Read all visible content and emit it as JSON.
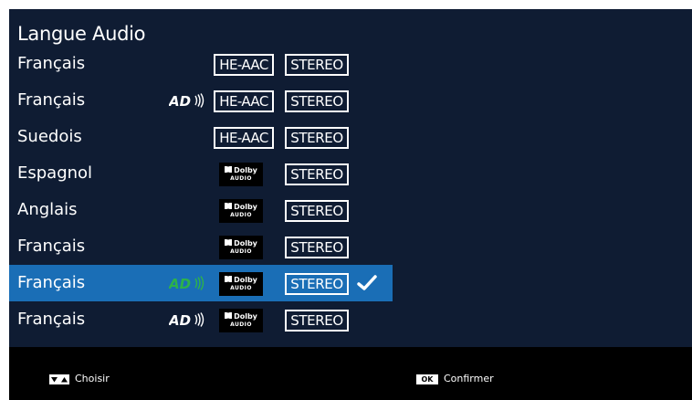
{
  "panel": {
    "title": "Langue Audio"
  },
  "tracks": [
    {
      "language": "Français",
      "audio_description": false,
      "codec": "HE-AAC",
      "channels": "STEREO",
      "selected": false
    },
    {
      "language": "Français",
      "audio_description": true,
      "codec": "HE-AAC",
      "channels": "STEREO",
      "selected": false
    },
    {
      "language": "Suedois",
      "audio_description": false,
      "codec": "HE-AAC",
      "channels": "STEREO",
      "selected": false
    },
    {
      "language": "Espagnol",
      "audio_description": false,
      "codec": "dolby-audio-logo",
      "channels": "STEREO",
      "selected": false
    },
    {
      "language": "Anglais",
      "audio_description": false,
      "codec": "dolby-audio-logo",
      "channels": "STEREO",
      "selected": false
    },
    {
      "language": "Français",
      "audio_description": false,
      "codec": "dolby-audio-logo",
      "channels": "STEREO",
      "selected": false
    },
    {
      "language": "Français",
      "audio_description": true,
      "codec": "dolby-audio-logo",
      "channels": "STEREO",
      "selected": true
    },
    {
      "language": "Français",
      "audio_description": true,
      "codec": "dolby-audio-logo",
      "channels": "STEREO",
      "selected": false
    }
  ],
  "dolby_logo": {
    "line1": "Dolby",
    "line2": "AUDIO"
  },
  "footer": {
    "choose_key": "updown-arrows-icon",
    "choose_label": "Choisir",
    "confirm_key": "OK",
    "confirm_label": "Confirmer"
  },
  "colors": {
    "background": "#0f1c33",
    "selected_row": "#1a6eb6",
    "footer": "#000000",
    "ad_icon_selected": "#2db24a",
    "text": "#ffffff"
  }
}
